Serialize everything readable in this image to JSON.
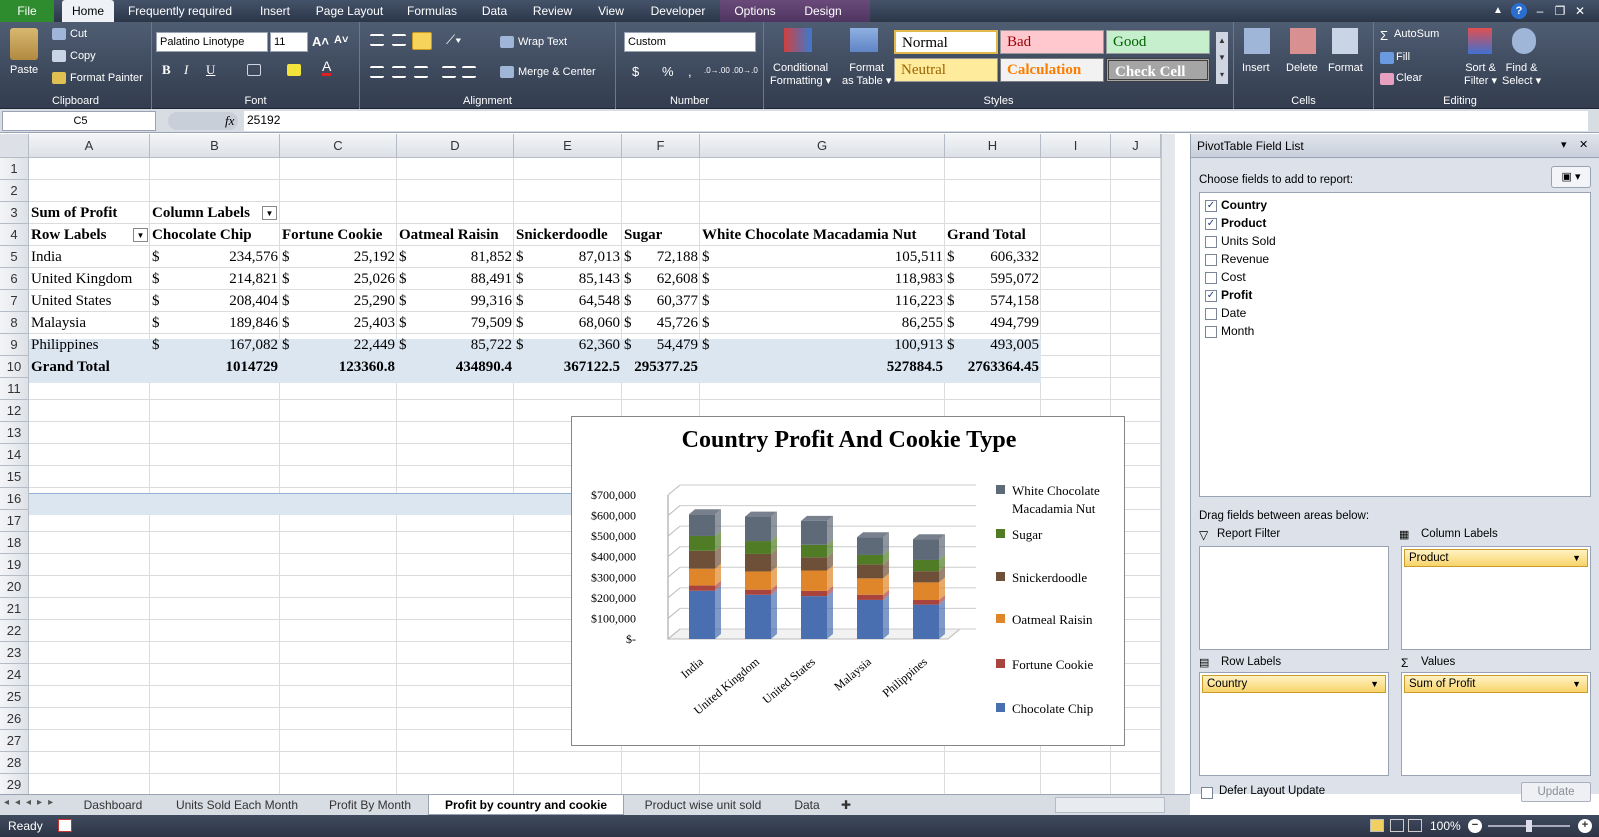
{
  "ribbon": {
    "tabs": [
      "File",
      "Home",
      "Frequently required",
      "Insert",
      "Page Layout",
      "Formulas",
      "Data",
      "Review",
      "View",
      "Developer",
      "Options",
      "Design"
    ],
    "clipboard": {
      "paste": "Paste",
      "cut": "Cut",
      "copy": "Copy",
      "format_painter": "Format Painter",
      "label": "Clipboard"
    },
    "font": {
      "name": "Palatino Linotype",
      "size": "11",
      "bold": "B",
      "italic": "I",
      "underline": "U",
      "label": "Font"
    },
    "alignment": {
      "wrap": "Wrap Text",
      "merge": "Merge & Center",
      "label": "Alignment"
    },
    "number": {
      "format": "Custom",
      "dollar": "$",
      "percent": "%",
      "comma": ",",
      "inc": ".0→.00",
      "dec": ".00→.0",
      "label": "Number"
    },
    "styles": {
      "conditional": "Conditional",
      "formatting": "Formatting",
      "format_as": "Format",
      "table": "as Table",
      "normal": "Normal",
      "bad": "Bad",
      "good": "Good",
      "neutral": "Neutral",
      "calculation": "Calculation",
      "check": "Check Cell",
      "label": "Styles"
    },
    "cells": {
      "insert": "Insert",
      "delete": "Delete",
      "format": "Format",
      "label": "Cells"
    },
    "editing": {
      "autosum": "AutoSum",
      "fill": "Fill",
      "clear": "Clear",
      "sort": "Sort &",
      "filter": "Filter",
      "find": "Find &",
      "select": "Select",
      "label": "Editing"
    }
  },
  "formula_bar": {
    "name_box": "C5",
    "fx": "fx",
    "value": "25192"
  },
  "columns": [
    "A",
    "B",
    "C",
    "D",
    "E",
    "F",
    "G",
    "H",
    "I",
    "J"
  ],
  "rows": [
    "1",
    "2",
    "3",
    "4",
    "5",
    "6",
    "7",
    "8",
    "9",
    "10",
    "11",
    "12",
    "13",
    "14",
    "15",
    "16",
    "17",
    "18",
    "19",
    "20",
    "21",
    "22",
    "23",
    "24",
    "25",
    "26",
    "27",
    "28",
    "29"
  ],
  "pivot": {
    "corner": "Sum of Profit",
    "col_labels": "Column Labels",
    "row_labels": "Row Labels",
    "headers": [
      "Chocolate Chip",
      "Fortune Cookie",
      "Oatmeal Raisin",
      "Snickerdoodle",
      "Sugar",
      "White Chocolate Macadamia Nut",
      "Grand Total"
    ],
    "currency": "$",
    "rows": [
      {
        "label": "India",
        "values": [
          "234,576",
          "25,192",
          "81,852",
          "87,013",
          "72,188",
          "105,511",
          "606,332"
        ]
      },
      {
        "label": "United Kingdom",
        "values": [
          "214,821",
          "25,026",
          "88,491",
          "85,143",
          "62,608",
          "118,983",
          "595,072"
        ]
      },
      {
        "label": "United States",
        "values": [
          "208,404",
          "25,290",
          "99,316",
          "64,548",
          "60,377",
          "116,223",
          "574,158"
        ]
      },
      {
        "label": "Malaysia",
        "values": [
          "189,846",
          "25,403",
          "79,509",
          "68,060",
          "45,726",
          "86,255",
          "494,799"
        ]
      },
      {
        "label": "Philippines",
        "values": [
          "167,082",
          "22,449",
          "85,722",
          "62,360",
          "54,479",
          "100,913",
          "493,005"
        ]
      }
    ],
    "grand_total": {
      "label": "Grand Total",
      "values": [
        "1014729",
        "123360.8",
        "434890.4",
        "367122.5",
        "295377.25",
        "527884.5",
        "2763364.45"
      ]
    }
  },
  "chart_data": {
    "type": "bar",
    "title": "Country Profit And Cookie Type",
    "stacked": true,
    "categories": [
      "India",
      "United Kingdom",
      "United States",
      "Malaysia",
      "Philippines"
    ],
    "yticks": [
      "$-",
      "$100,000",
      "$200,000",
      "$300,000",
      "$400,000",
      "$500,000",
      "$600,000",
      "$700,000"
    ],
    "ylim": [
      0,
      700000
    ],
    "legend_position": "right",
    "series": [
      {
        "name": "Chocolate Chip",
        "color": "#4a6fb0",
        "values": [
          234576,
          214821,
          208404,
          189846,
          167082
        ]
      },
      {
        "name": "Fortune Cookie",
        "color": "#a8433d",
        "values": [
          25192,
          25026,
          25290,
          25403,
          22449
        ]
      },
      {
        "name": "Oatmeal Raisin",
        "color": "#e0862a",
        "values": [
          81852,
          88491,
          99316,
          79509,
          85722
        ]
      },
      {
        "name": "Snickerdoodle",
        "color": "#6e5038",
        "values": [
          87013,
          85143,
          64548,
          68060,
          54479
        ]
      },
      {
        "name": "Sugar",
        "color": "#4f7c24",
        "values": [
          72188,
          62608,
          60377,
          45726,
          54479
        ]
      },
      {
        "name": "White Chocolate Macadamia Nut",
        "color": "#5f6a78",
        "values": [
          105511,
          118983,
          116223,
          86255,
          100913
        ]
      }
    ],
    "legend_lines": [
      [
        "White Chocolate",
        "Macadamia Nut"
      ],
      [
        "Sugar"
      ],
      [
        "Snickerdoodle"
      ],
      [
        "Oatmeal Raisin"
      ],
      [
        "Fortune Cookie"
      ],
      [
        "Chocolate Chip"
      ]
    ]
  },
  "field_list": {
    "title": "PivotTable Field List",
    "choose": "Choose fields to add to report:",
    "fields": [
      {
        "name": "Country",
        "checked": true
      },
      {
        "name": "Product",
        "checked": true
      },
      {
        "name": "Units Sold",
        "checked": false
      },
      {
        "name": "Revenue",
        "checked": false
      },
      {
        "name": "Cost",
        "checked": false
      },
      {
        "name": "Profit",
        "checked": true
      },
      {
        "name": "Date",
        "checked": false
      },
      {
        "name": "Month",
        "checked": false
      }
    ],
    "drag": "Drag fields between areas below:",
    "report_filter": "Report Filter",
    "column_labels": "Column Labels",
    "column_item": "Product",
    "row_labels": "Row Labels",
    "row_item": "Country",
    "values": "Values",
    "values_item": "Sum of Profit",
    "defer": "Defer Layout Update",
    "update": "Update"
  },
  "sheet_tabs": [
    "Dashboard",
    "Units Sold Each Month",
    "Profit By Month",
    "Profit by country and cookie",
    "Product wise unit sold",
    "Data"
  ],
  "active_sheet": "Profit by country and cookie",
  "status": {
    "ready": "Ready",
    "zoom": "100%"
  }
}
